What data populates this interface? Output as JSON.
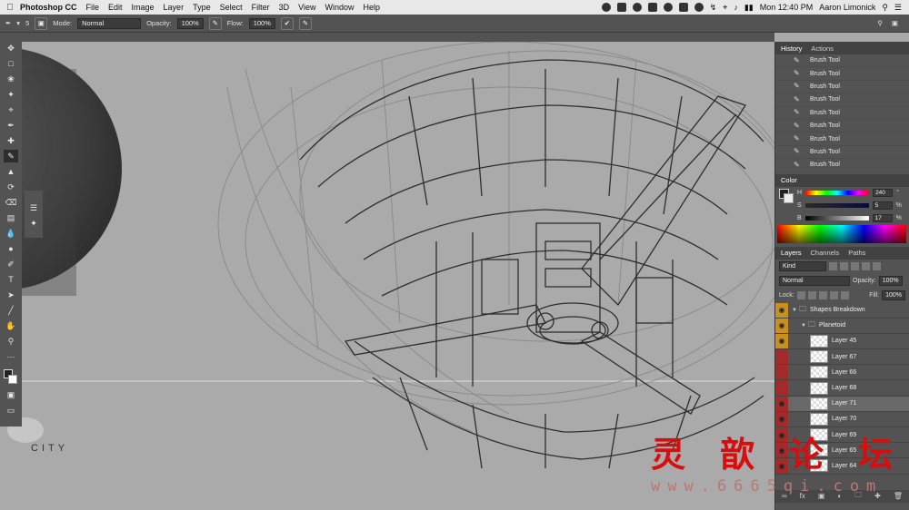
{
  "menubar": {
    "app_name": "Photoshop CC",
    "menu_items": [
      "File",
      "Edit",
      "Image",
      "Layer",
      "Type",
      "Select",
      "Filter",
      "3D",
      "View",
      "Window",
      "Help"
    ],
    "clock": "Mon 12:40 PM",
    "user": "Aaron Limonick"
  },
  "options": {
    "brush_size": "5",
    "mode_label": "Mode:",
    "mode_value": "Normal",
    "opacity_label": "Opacity:",
    "opacity_value": "100%",
    "flow_label": "Flow:",
    "flow_value": "100%"
  },
  "canvas": {
    "text_label": "CITY"
  },
  "history": {
    "tabs": [
      "History",
      "Actions"
    ],
    "items": [
      "Brush Tool",
      "Brush Tool",
      "Brush Tool",
      "Brush Tool",
      "Brush Tool",
      "Brush Tool",
      "Brush Tool",
      "Brush Tool",
      "Brush Tool"
    ]
  },
  "color": {
    "tab": "Color",
    "h_label": "H",
    "h_value": "240",
    "h_unit": "°",
    "s_label": "S",
    "s_value": "5",
    "s_unit": "%",
    "b_label": "B",
    "b_value": "17",
    "b_unit": "%"
  },
  "layers": {
    "tabs": [
      "Layers",
      "Channels",
      "Paths"
    ],
    "kind_label": "Kind",
    "blend_mode": "Normal",
    "opacity_label": "Opacity:",
    "opacity_value": "100%",
    "lock_label": "Lock:",
    "fill_label": "Fill:",
    "fill_value": "100%",
    "rows": [
      {
        "name": "Shapes Breakdown",
        "type": "group",
        "eye": "amber"
      },
      {
        "name": "Planetoid",
        "type": "group",
        "eye": "amber"
      },
      {
        "name": "Layer 45",
        "type": "layer",
        "eye": "amber"
      },
      {
        "name": "Layer 67",
        "type": "layer",
        "eye": "red"
      },
      {
        "name": "Layer 66",
        "type": "layer",
        "eye": "red"
      },
      {
        "name": "Layer 68",
        "type": "layer",
        "eye": "red"
      },
      {
        "name": "Layer 71",
        "type": "layer",
        "eye": "red",
        "selected": true
      },
      {
        "name": "Layer 70",
        "type": "layer",
        "eye": "red"
      },
      {
        "name": "Layer 69",
        "type": "layer",
        "eye": "red"
      },
      {
        "name": "Layer 65",
        "type": "layer",
        "eye": "red"
      },
      {
        "name": "Layer 64",
        "type": "layer",
        "eye": "red"
      }
    ]
  },
  "colors": {
    "eye_amber": "#c8911e",
    "eye_red": "#a32a2a",
    "panel_bg": "#535353",
    "canvas_bg": "#aaaaaa",
    "watermark_red": "#d80e0e"
  },
  "watermark": {
    "chars": [
      "灵",
      "歆",
      "论",
      "坛"
    ],
    "url": "www.6665qi.com"
  }
}
